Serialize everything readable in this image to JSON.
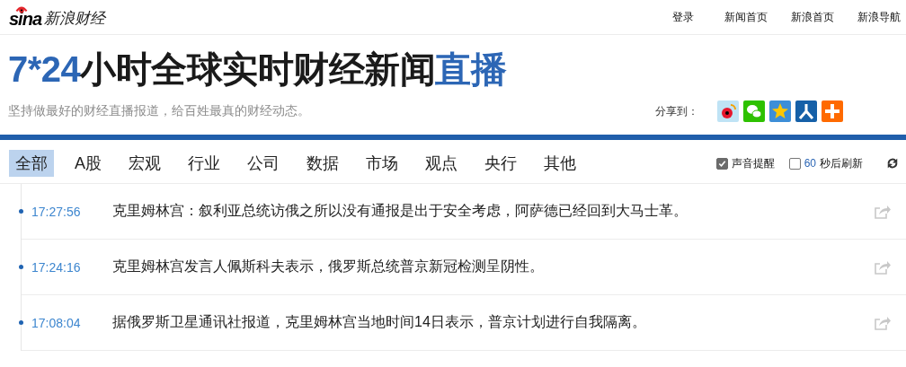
{
  "header": {
    "logo": "sina",
    "site_name": "新浪财经",
    "links": [
      "登录",
      "新闻首页",
      "新浪首页",
      "新浪导航"
    ]
  },
  "hero": {
    "title_parts": [
      {
        "text": "7*24",
        "highlight": true
      },
      {
        "text": "小时全球实时财经新闻",
        "highlight": false
      },
      {
        "text": "直播",
        "highlight": true
      }
    ],
    "subtitle": "坚持做最好的财经直播报道，给百姓最真的财经动态。",
    "share_label": "分享到：",
    "share_targets": [
      {
        "kind": "weibo"
      },
      {
        "kind": "wechat"
      },
      {
        "kind": "qzone"
      },
      {
        "kind": "renren"
      },
      {
        "kind": "more"
      }
    ]
  },
  "tabs": [
    {
      "label": "全部",
      "selected": true
    },
    {
      "label": "A股",
      "selected": false
    },
    {
      "label": "宏观",
      "selected": false
    },
    {
      "label": "行业",
      "selected": false
    },
    {
      "label": "公司",
      "selected": false
    },
    {
      "label": "数据",
      "selected": false
    },
    {
      "label": "市场",
      "selected": false
    },
    {
      "label": "观点",
      "selected": false
    },
    {
      "label": "央行",
      "selected": false
    },
    {
      "label": "其他",
      "selected": false
    }
  ],
  "options": {
    "sound_alert": {
      "label": "声音提醒",
      "checked": true
    },
    "auto_refresh": {
      "seconds": "60",
      "label": "秒后刷新",
      "checked": false
    }
  },
  "feed": [
    {
      "time": "17:27:56",
      "text": "克里姆林宫：叙利亚总统访俄之所以没有通报是出于安全考虑，阿萨德已经回到大马士革。"
    },
    {
      "time": "17:24:16",
      "text": "克里姆林宫发言人佩斯科夫表示，俄罗斯总统普京新冠检测呈阴性。"
    },
    {
      "time": "17:08:04",
      "text": "据俄罗斯卫星通讯社报道，克里姆林宫当地时间14日表示，普京计划进行自我隔离。"
    }
  ]
}
